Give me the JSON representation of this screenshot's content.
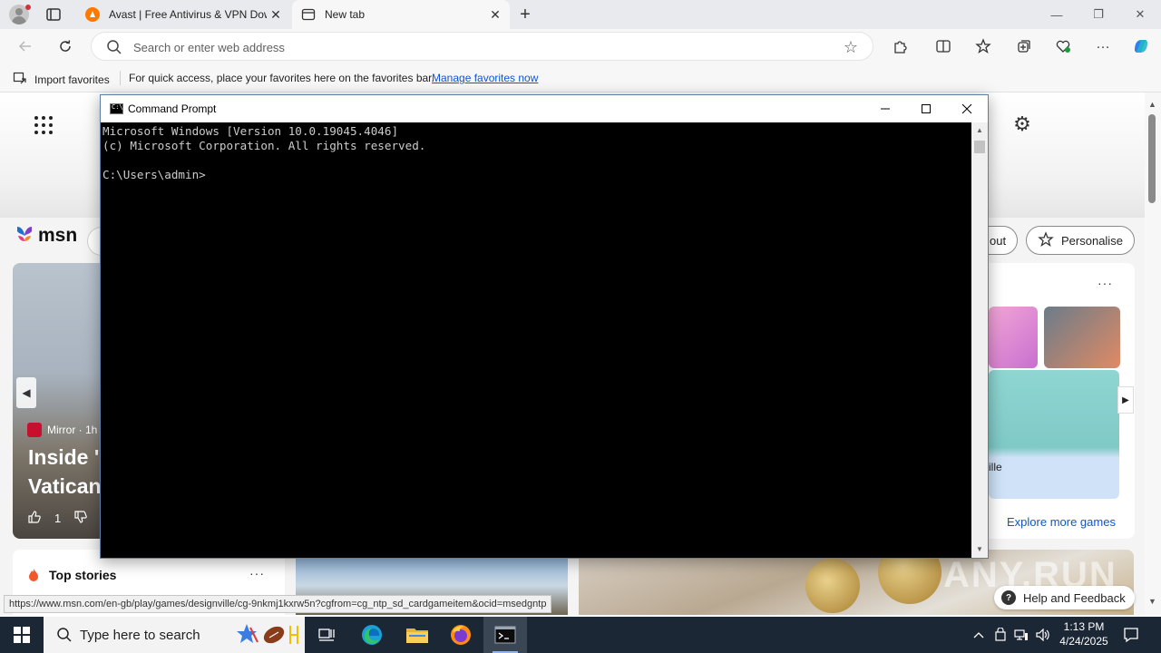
{
  "browser": {
    "tabs": [
      {
        "title": "Avast | Free Antivirus & VPN Dow",
        "icon": "avast-icon",
        "active": false
      },
      {
        "title": "New tab",
        "icon": "new-tab-page-icon",
        "active": true
      }
    ],
    "window_controls": {
      "minimize": "—",
      "restore": "❐",
      "close": "✕"
    },
    "address": {
      "value": "",
      "placeholder": "Search or enter web address"
    },
    "favorites_bar": {
      "import_label": "Import favorites",
      "hint": "For quick access, place your favorites here on the favorites bar.",
      "manage_link": "Manage favorites now"
    }
  },
  "msn": {
    "logo_text": "msn",
    "layout_pill": "out",
    "personalise_label": "Personalise",
    "news_card": {
      "source": "Mirror · 1h",
      "headline_line1": "Inside '",
      "headline_line2": "Vatican",
      "likes": "1"
    },
    "games_card": {
      "caption": "ille",
      "explore_link": "Explore more games"
    },
    "top_stories_label": "Top stories",
    "more_glyph": "···",
    "help_label": "Help and Feedback",
    "watermark": "ANY.RUN"
  },
  "status_url": "https://www.msn.com/en-gb/play/games/designville/cg-9nkmj1kxrw5n?cgfrom=cg_ntp_sd_cardgameitem&ocid=msedgntp",
  "cmd": {
    "title": "Command Prompt",
    "lines": [
      "Microsoft Windows [Version 10.0.19045.4046]",
      "(c) Microsoft Corporation. All rights reserved.",
      "",
      "C:\\Users\\admin>"
    ]
  },
  "taskbar": {
    "search_placeholder": "Type here to search",
    "time": "1:13 PM",
    "date": "4/24/2025"
  },
  "colors": {
    "edge_chrome": "#f7f7f7",
    "tab_strip": "#e9eaed",
    "link_blue": "#0b57d0",
    "taskbar": "#1c2735",
    "console_bg": "#000000",
    "console_text": "#cccccc"
  }
}
